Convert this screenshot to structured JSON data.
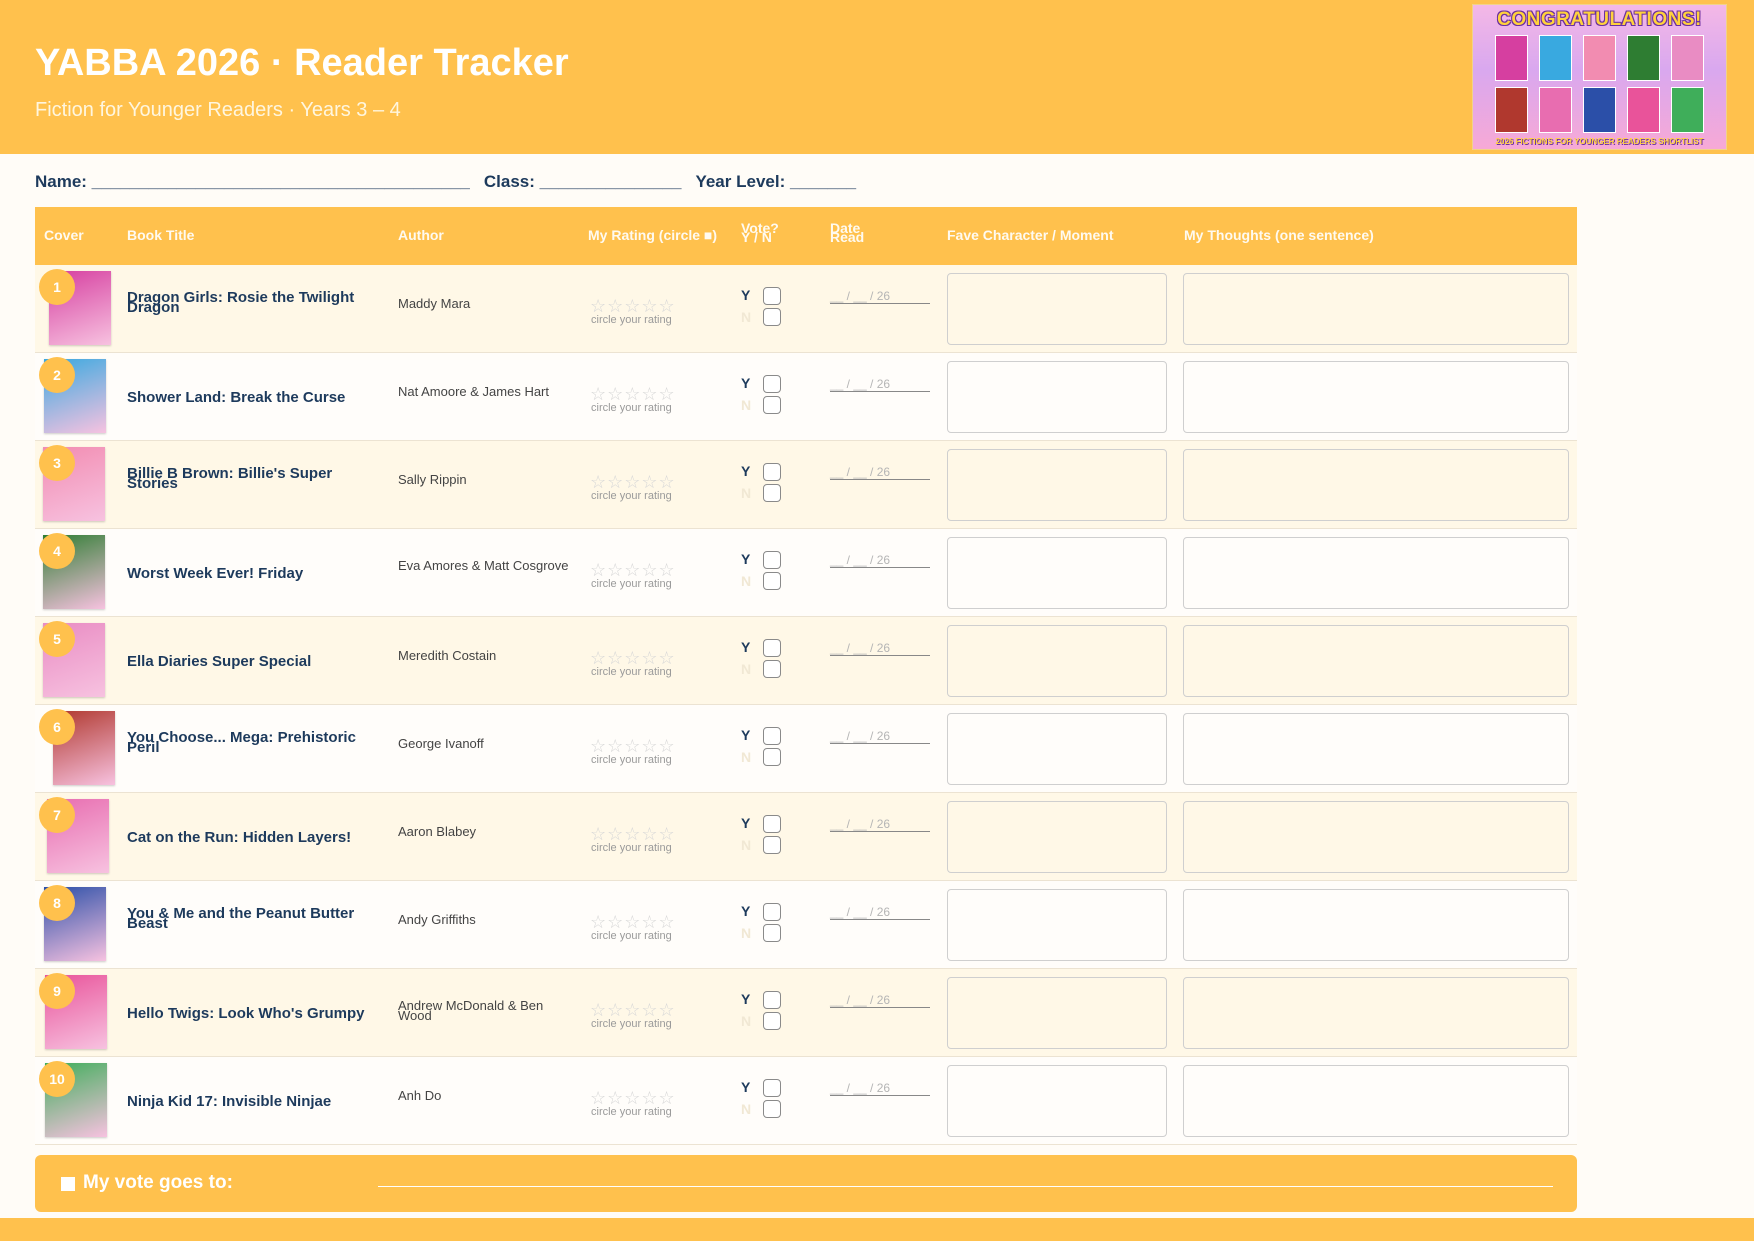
{
  "header": {
    "title": "YABBA 2026  ·  Reader Tracker",
    "subtitle": "Fiction for Younger Readers  ·  Years 3 – 4",
    "poster_title": "CONGRATULATIONS!",
    "poster_foot": "2026 FICTIONS FOR YOUNGER READERS SHORTLIST"
  },
  "student": {
    "name_label": "Name: ________________________________________",
    "class_label": "Class: _______________",
    "year_label": "Year Level: _______"
  },
  "columns": {
    "cover": "Cover",
    "title": "Book Title",
    "author": "Author",
    "rating": "My Rating (circle ■)",
    "vote": "Vote?",
    "vote_sub": "Y / N",
    "date": "Date",
    "date_sub": "Read",
    "fave": "Fave Character / Moment",
    "thoughts": "My Thoughts (one sentence)"
  },
  "row_labels": {
    "stars": "☆☆☆☆☆",
    "rating_note": "circle your rating",
    "yes": "Y",
    "no": "N",
    "date_template": "__ / __ / 26"
  },
  "books": [
    {
      "num": "1",
      "title": "Dragon Girls: Rosie the Twilight Dragon",
      "author": "Maddy Mara",
      "cover_color": "#d63fa0"
    },
    {
      "num": "2",
      "title": "Shower Land: Break the Curse",
      "author": "Nat Amoore & James Hart",
      "cover_color": "#39a9e0"
    },
    {
      "num": "3",
      "title": "Billie B Brown: Billie's Super Stories",
      "author": "Sally Rippin",
      "cover_color": "#f28cb1"
    },
    {
      "num": "4",
      "title": "Worst Week Ever! Friday",
      "author": "Eva Amores & Matt Cosgrove",
      "cover_color": "#2e7d32"
    },
    {
      "num": "5",
      "title": "Ella Diaries Super Special",
      "author": "Meredith Costain",
      "cover_color": "#e98cc3"
    },
    {
      "num": "6",
      "title": "You Choose... Mega: Prehistoric Peril",
      "author": "George Ivanoff",
      "cover_color": "#b0382e"
    },
    {
      "num": "7",
      "title": "Cat on the Run: Hidden Layers!",
      "author": "Aaron Blabey",
      "cover_color": "#e86db0"
    },
    {
      "num": "8",
      "title": "You & Me and the Peanut Butter Beast",
      "author": "Andy Griffiths",
      "cover_color": "#2b4fa8"
    },
    {
      "num": "9",
      "title": "Hello Twigs: Look Who's Grumpy",
      "author": "Andrew McDonald & Ben Wood",
      "cover_color": "#e9539a"
    },
    {
      "num": "10",
      "title": "Ninja Kid 17: Invisible Ninjae",
      "author": "Anh Do",
      "cover_color": "#3fae5a"
    }
  ],
  "footer": {
    "label": "My vote goes to:"
  }
}
